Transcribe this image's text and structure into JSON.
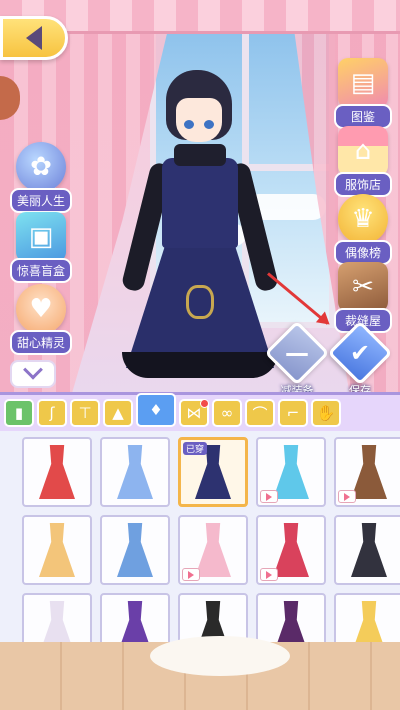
{
  "left_menu": [
    {
      "label": "美丽人生",
      "icon": "rainbow-icon"
    },
    {
      "label": "惊喜盲盒",
      "icon": "gift-box-icon"
    },
    {
      "label": "甜心精灵",
      "icon": "cake-fairy-icon"
    }
  ],
  "right_menu": [
    {
      "label": "图鉴",
      "icon": "book-icon"
    },
    {
      "label": "服饰店",
      "icon": "shop-icon"
    },
    {
      "label": "偶像榜",
      "icon": "trophy-icon"
    },
    {
      "label": "裁缝屋",
      "icon": "sewing-machine-icon"
    }
  ],
  "actions": {
    "remove_label": "减装备",
    "save_label": "保存"
  },
  "tabs": [
    {
      "icon": "dress-tab-icon"
    },
    {
      "icon": "socks-icon"
    },
    {
      "icon": "top-icon"
    },
    {
      "icon": "skirt-icon"
    },
    {
      "icon": "dress-icon",
      "active": true
    },
    {
      "icon": "hair-bow-icon",
      "dot": true
    },
    {
      "icon": "earring-icon"
    },
    {
      "icon": "hat-icon"
    },
    {
      "icon": "shoe-icon"
    },
    {
      "icon": "hand-icon"
    }
  ],
  "worn_label": "已穿",
  "items": [
    {
      "color": "#e24a4a",
      "video": false
    },
    {
      "color": "#8db4ef",
      "video": false
    },
    {
      "color": "#2d3270",
      "video": false,
      "worn": true
    },
    {
      "color": "#5fc8ea",
      "video": true
    },
    {
      "color": "#8b5a3a",
      "video": true
    },
    {
      "color": "#f3c57a",
      "video": false
    },
    {
      "color": "#6fa0e0",
      "video": false
    },
    {
      "color": "#f5b9cc",
      "video": true
    },
    {
      "color": "#d9425c",
      "video": true
    },
    {
      "color": "#32323e",
      "video": false
    },
    {
      "color": "#e8e0f0",
      "video": false
    },
    {
      "color": "#6a3fa8",
      "video": false
    },
    {
      "color": "#2a2a2a",
      "video": false
    },
    {
      "color": "#5a2a68",
      "video": false
    },
    {
      "color": "#f4cc5a",
      "video": false
    }
  ]
}
